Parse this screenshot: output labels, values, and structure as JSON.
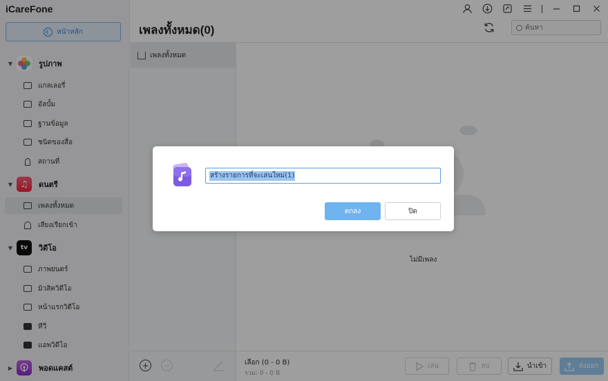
{
  "app": {
    "title": "iCareFone"
  },
  "sidebar": {
    "home_label": "หน้าหลัก",
    "categories": [
      {
        "label": "รูปภาพ",
        "icon": "photos-app-icon",
        "items": [
          "แกลเลอรี่",
          "อัลบั้ม",
          "ฐานข้อมูล",
          "ชนิดของสื่อ",
          "สถานที่"
        ]
      },
      {
        "label": "ดนตรี",
        "icon": "music-app-icon",
        "items": [
          "เพลงทั้งหมด",
          "เสียงเรียกเข้า"
        ]
      },
      {
        "label": "วิดีโอ",
        "icon": "appletv-app-icon",
        "tv_text": "tv",
        "items": [
          "ภาพยนตร์",
          "มิวสิควิดีโอ",
          "หน้าแรกวิดีโอ",
          "ทีวี",
          "แอพวิดีโอ"
        ]
      },
      {
        "label": "พอดแคสต์",
        "icon": "podcasts-app-icon"
      }
    ]
  },
  "header": {
    "title": "เพลงทั้งหมด(0)",
    "search_placeholder": "ค้นหา"
  },
  "playlists": {
    "all_songs": "เพลงทั้งหมด"
  },
  "songs": {
    "empty_text": "ไม่มีเพลง"
  },
  "bottom": {
    "selection": "เลือก (0 - 0 B)",
    "total": "รวม: 0 - 0 B",
    "play_label": "เล่น",
    "delete_label": "ลบ",
    "import_label": "นำเข้า",
    "export_label": "ส่งออก"
  },
  "dialog": {
    "input_value": "สร้างรายการที่จะเล่นใหม่(1)",
    "ok_label": "ตกลง",
    "close_label": "ปิด"
  },
  "colors": {
    "accent": "#3a86d6",
    "primary_button": "#6fb3ef"
  }
}
